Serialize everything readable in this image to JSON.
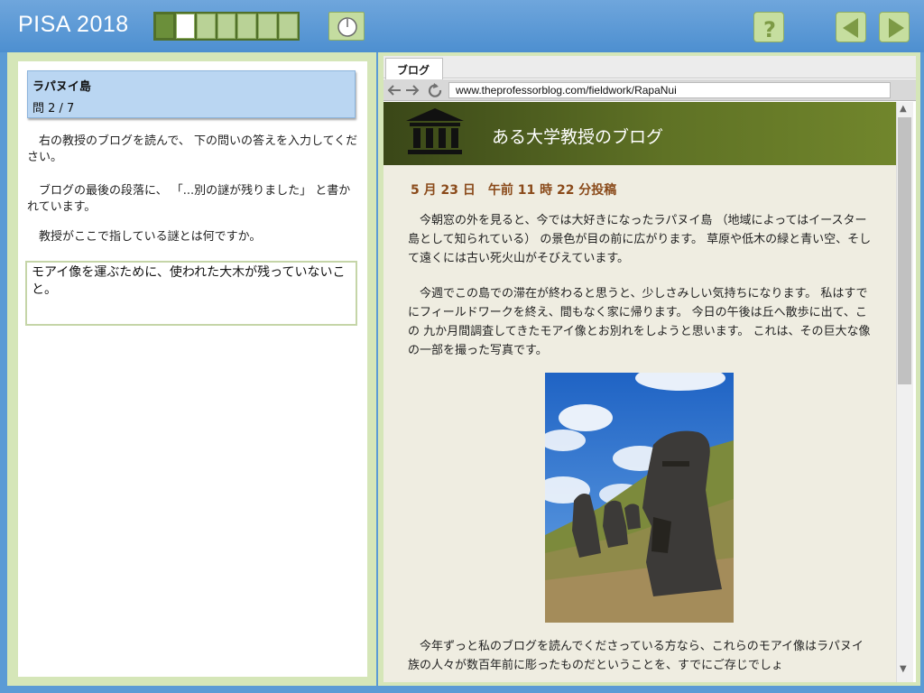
{
  "app": {
    "title": "PISA 2018",
    "progress": {
      "total": 7,
      "current": 2
    }
  },
  "question": {
    "unit_title": "ラパヌイ島",
    "counter": "問 2 / 7",
    "instruction_1": "　右の教授のブログを読んで、 下の問いの答えを入力してください。",
    "instruction_2": "　ブログの最後の段落に、 「...別の謎が残りました」 と書かれています。",
    "instruction_3": "　教授がここで指している謎とは何ですか。",
    "answer": "モアイ像を運ぶために、使われた大木が残っていないこと。"
  },
  "browser": {
    "tab_label": "ブログ",
    "url": "www.theprofessorblog.com/fieldwork/RapaNui"
  },
  "blog": {
    "title": "ある大学教授のブログ",
    "post_date": "5 月 23 日　午前 11 時 22 分投稿",
    "paragraph_1": "　今朝窓の外を見ると、今では大好きになったラパヌイ島 （地域によってはイースター島として知られている） の景色が目の前に広がります。 草原や低木の緑と青い空、そして遠くには古い死火山がそびえています。",
    "paragraph_2": "　今週でこの島での滞在が終わると思うと、少しさみしい気持ちになります。 私はすでにフィールドワークを終え、間もなく家に帰ります。 今日の午後は丘へ散歩に出て、この 九か月間調査してきたモアイ像とお別れをしようと思います。 これは、その巨大な像の一部を撮った写真です。",
    "paragraph_3": "　今年ずっと私のブログを読んでくださっている方なら、これらのモアイ像はラパヌイ族の人々が数百年前に彫ったものだということを、すでにご存じでしょ"
  },
  "icons": {
    "timer": "timer-icon",
    "help": "question-mark-icon",
    "prev": "triangle-left-icon",
    "next": "triangle-right-icon",
    "blog_logo": "building-columns-icon"
  },
  "colors": {
    "topbar": "#4d8fd0",
    "button_green": "#c6de9f",
    "icon_green": "#7d9a45",
    "banner": "#5f7225",
    "date_text": "#8a4a1a"
  }
}
